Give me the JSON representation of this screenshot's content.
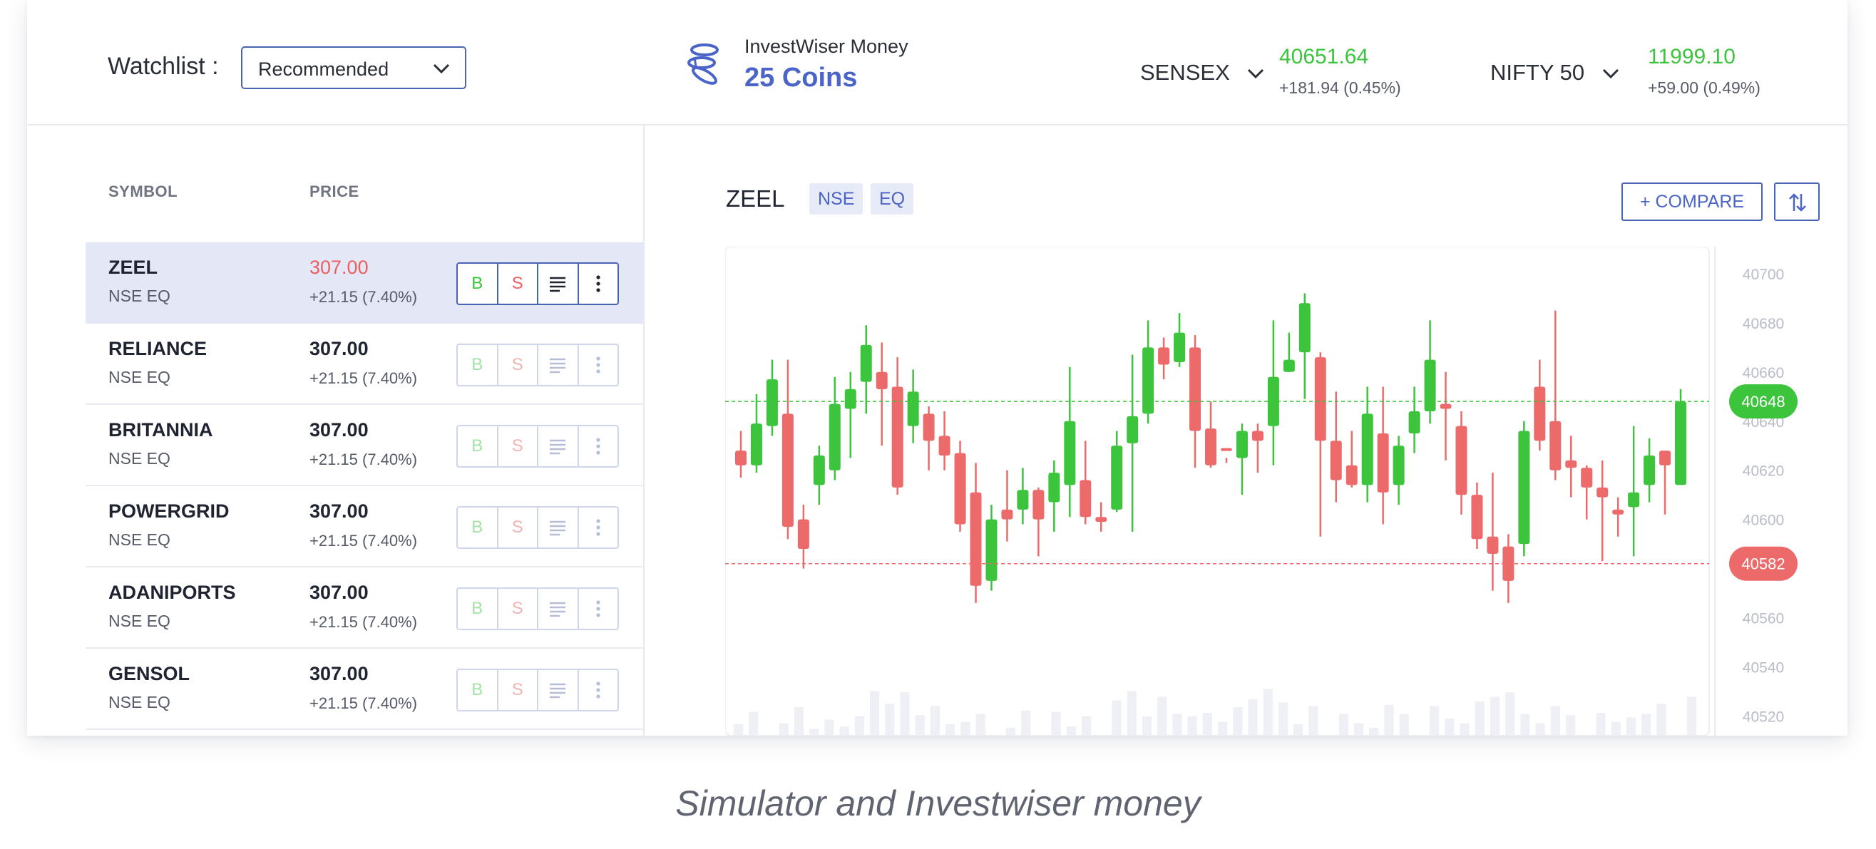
{
  "watchlist": {
    "label": "Watchlist :",
    "selected": "Recommended"
  },
  "money": {
    "title": "InvestWiser Money",
    "coins": "25 Coins",
    "icon": "coins-icon"
  },
  "indices": [
    {
      "name": "SENSEX",
      "value": "40651.64",
      "change": "+181.94 (0.45%)"
    },
    {
      "name": "NIFTY 50",
      "value": "11999.10",
      "change": "+59.00 (0.49%)"
    }
  ],
  "table": {
    "headers": {
      "symbol": "SYMBOL",
      "price": "PRICE"
    },
    "rows": [
      {
        "symbol": "ZEEL",
        "exchange": "NSE EQ",
        "price": "307.00",
        "change": "+21.15 (7.40%)",
        "buy": "B",
        "sell": "S"
      },
      {
        "symbol": "RELIANCE",
        "exchange": "NSE EQ",
        "price": "307.00",
        "change": "+21.15 (7.40%)",
        "buy": "B",
        "sell": "S"
      },
      {
        "symbol": "BRITANNIA",
        "exchange": "NSE EQ",
        "price": "307.00",
        "change": "+21.15 (7.40%)",
        "buy": "B",
        "sell": "S"
      },
      {
        "symbol": "POWERGRID",
        "exchange": "NSE EQ",
        "price": "307.00",
        "change": "+21.15 (7.40%)",
        "buy": "B",
        "sell": "S"
      },
      {
        "symbol": "ADANIPORTS",
        "exchange": "NSE EQ",
        "price": "307.00",
        "change": "+21.15 (7.40%)",
        "buy": "B",
        "sell": "S"
      },
      {
        "symbol": "GENSOL",
        "exchange": "NSE EQ",
        "price": "307.00",
        "change": "+21.15 (7.40%)",
        "buy": "B",
        "sell": "S"
      }
    ]
  },
  "chart_header": {
    "symbol": "ZEEL",
    "tags": [
      "NSE",
      "EQ"
    ],
    "compare_label": "+ COMPARE",
    "swap_icon": "swap-vertical-icon"
  },
  "colors": {
    "up": "#3cc43c",
    "down": "#ec6a6a",
    "accent": "#4a64b4"
  },
  "chart_data": {
    "type": "candlestick",
    "y_ticks": [
      40700,
      40680,
      40660,
      40640,
      40620,
      40600,
      40580,
      40560,
      40540,
      40520
    ],
    "ylim": [
      40512,
      40711
    ],
    "current_price_label": {
      "value": 40648,
      "text": "40648"
    },
    "low_price_label": {
      "value": 40582,
      "text": "40582"
    },
    "candles": [
      [
        40628,
        40622,
        40636,
        40617
      ],
      [
        40622,
        40639,
        40651,
        40619
      ],
      [
        40638,
        40657,
        40665,
        40634
      ],
      [
        40643,
        40597,
        40665,
        40592
      ],
      [
        40600,
        40588,
        40606,
        40580
      ],
      [
        40614,
        40626,
        40630,
        40606
      ],
      [
        40620,
        40647,
        40658,
        40616
      ],
      [
        40645,
        40653,
        40660,
        40625
      ],
      [
        40656,
        40671,
        40679,
        40643
      ],
      [
        40660,
        40653,
        40672,
        40630
      ],
      [
        40654,
        40613,
        40666,
        40610
      ],
      [
        40638,
        40652,
        40661,
        40631
      ],
      [
        40643,
        40632,
        40646,
        40620
      ],
      [
        40634,
        40626,
        40644,
        40620
      ],
      [
        40627,
        40598,
        40632,
        40595
      ],
      [
        40611,
        40573,
        40623,
        40566
      ],
      [
        40575,
        40600,
        40606,
        40571
      ],
      [
        40604,
        40600,
        40620,
        40591
      ],
      [
        40604,
        40612,
        40621,
        40598
      ],
      [
        40612,
        40600,
        40613,
        40585
      ],
      [
        40607,
        40619,
        40624,
        40595
      ],
      [
        40614,
        40640,
        40662,
        40601
      ],
      [
        40616,
        40601,
        40632,
        40598
      ],
      [
        40601,
        40599,
        40607,
        40595
      ],
      [
        40604,
        40630,
        40636,
        40603
      ],
      [
        40631,
        40642,
        40667,
        40595
      ],
      [
        40643,
        40670,
        40681,
        40639
      ],
      [
        40670,
        40663,
        40674,
        40657
      ],
      [
        40664,
        40676,
        40684,
        40662
      ],
      [
        40670,
        40636,
        40675,
        40621
      ],
      [
        40637,
        40622,
        40648,
        40621
      ],
      [
        40629,
        40628,
        40625,
        40623
      ],
      [
        40625,
        40636,
        40639,
        40610
      ],
      [
        40636,
        40632,
        40639,
        40619
      ],
      [
        40638,
        40658,
        40681,
        40622
      ],
      [
        40660,
        40665,
        40676,
        40660
      ],
      [
        40668,
        40688,
        40692,
        40649
      ],
      [
        40666,
        40632,
        40668,
        40593
      ],
      [
        40632,
        40616,
        40652,
        40607
      ],
      [
        40622,
        40614,
        40636,
        40613
      ],
      [
        40614,
        40643,
        40654,
        40607
      ],
      [
        40635,
        40611,
        40654,
        40598
      ],
      [
        40614,
        40630,
        40634,
        40606
      ],
      [
        40635,
        40644,
        40654,
        40627
      ],
      [
        40644,
        40665,
        40681,
        40639
      ],
      [
        40647,
        40645,
        40660,
        40624
      ],
      [
        40638,
        40610,
        40644,
        40602
      ],
      [
        40610,
        40592,
        40615,
        40588
      ],
      [
        40593,
        40586,
        40619,
        40571
      ],
      [
        40589,
        40575,
        40594,
        40566
      ],
      [
        40590,
        40636,
        40640,
        40585
      ],
      [
        40654,
        40632,
        40665,
        40628
      ],
      [
        40640,
        40620,
        40685,
        40616
      ],
      [
        40624,
        40621,
        40634,
        40609
      ],
      [
        40621,
        40613,
        40622,
        40600
      ],
      [
        40613,
        40609,
        40624,
        40583
      ],
      [
        40604,
        40602,
        40609,
        40593
      ],
      [
        40605,
        40611,
        40638,
        40585
      ],
      [
        40614,
        40626,
        40633,
        40607
      ],
      [
        40628,
        40622,
        40623,
        40602
      ],
      [
        40614,
        40648,
        40653,
        40618
      ]
    ],
    "volume": [
      10,
      21,
      0,
      11,
      25,
      6,
      14,
      8,
      17,
      39,
      28,
      38,
      18,
      26,
      10,
      12,
      19,
      0,
      7,
      22,
      0,
      21,
      8,
      17,
      0,
      31,
      39,
      17,
      34,
      19,
      17,
      20,
      12,
      25,
      32,
      41,
      29,
      10,
      26,
      0,
      19,
      11,
      7,
      27,
      19,
      0,
      26,
      15,
      11,
      30,
      34,
      38,
      19,
      11,
      26,
      18,
      0,
      20,
      12,
      16,
      19,
      28,
      0,
      34
    ]
  },
  "caption": "Simulator and Investwiser money"
}
